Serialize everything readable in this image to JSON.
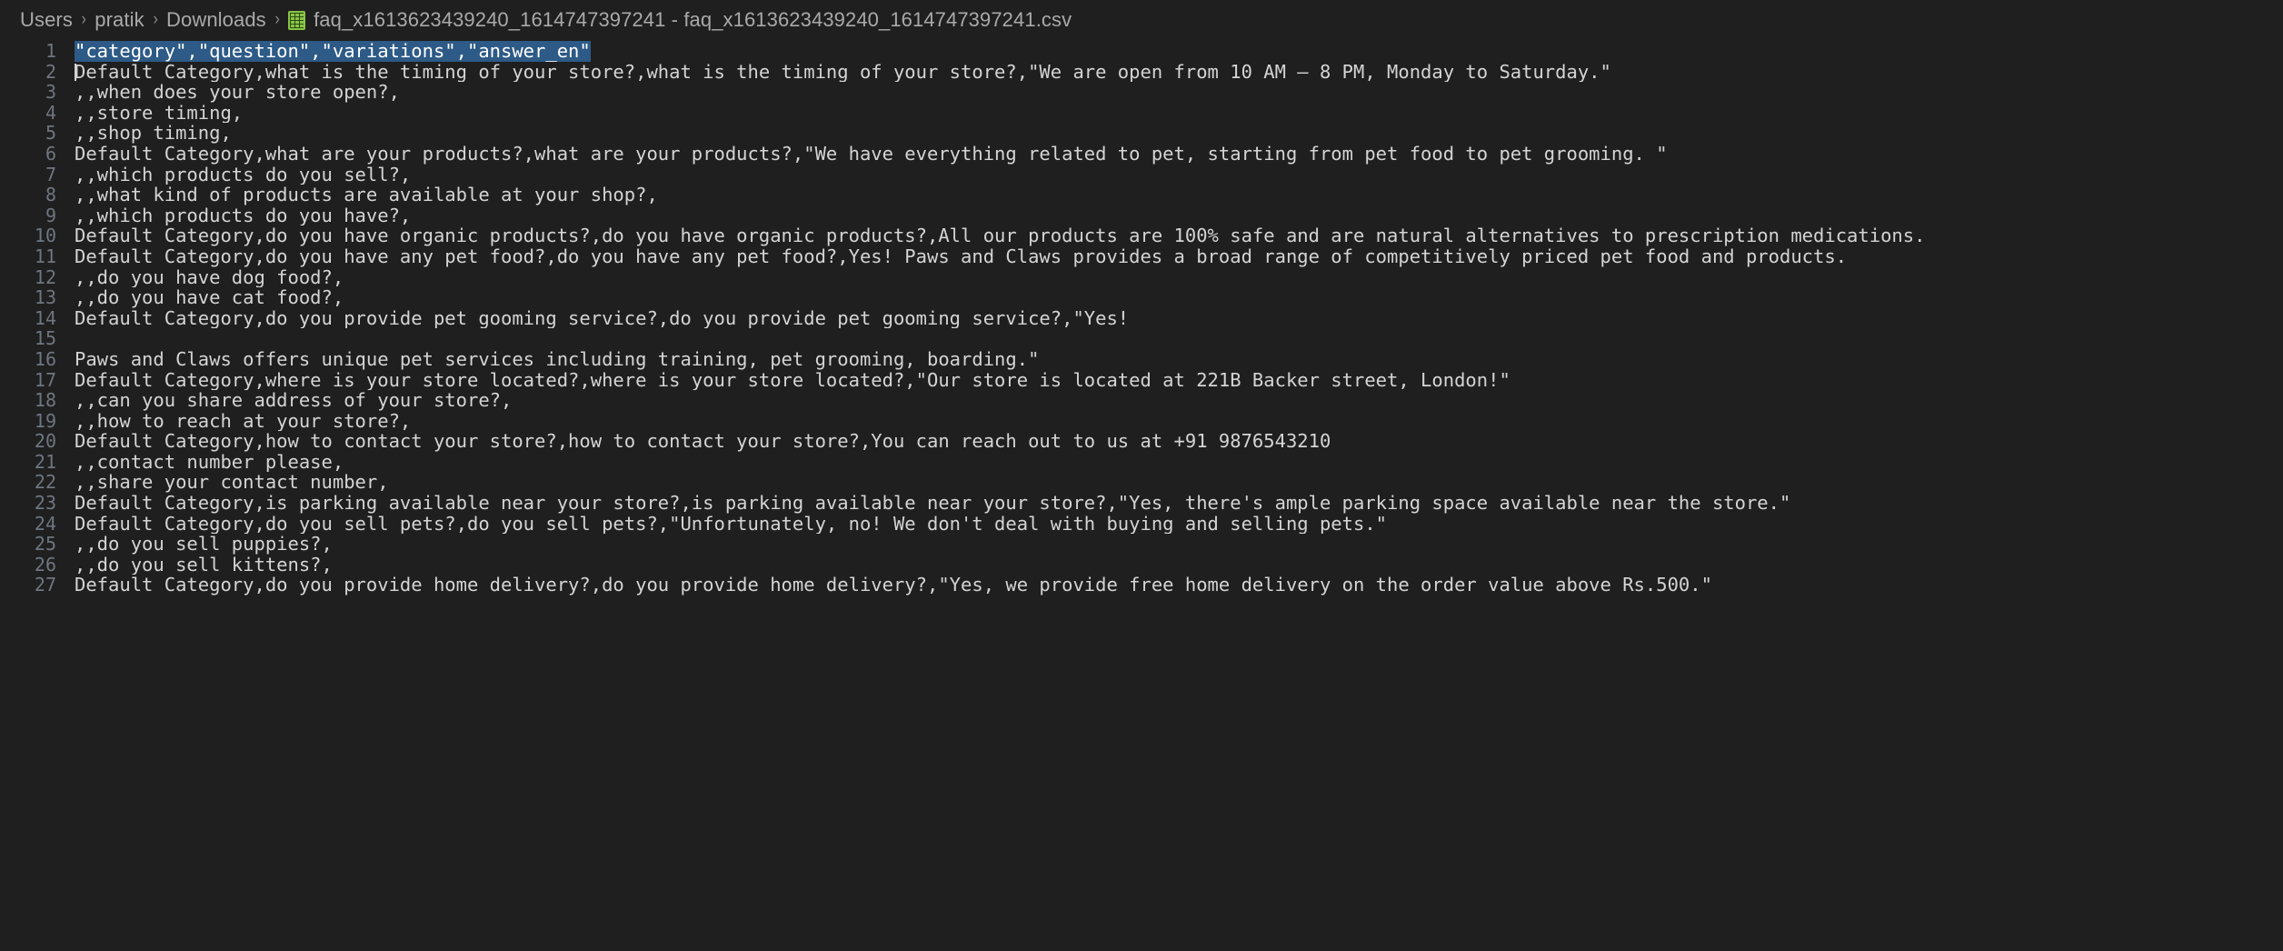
{
  "window": {
    "background_color": "#1f1f1f",
    "accent_color": "#2d5a86"
  },
  "breadcrumb": {
    "separator": "›",
    "items": [
      {
        "label": "Users"
      },
      {
        "label": "pratik"
      },
      {
        "label": "Downloads"
      }
    ],
    "file_icon_name": "csv-file-icon",
    "file_label": "faq_x1613623439240_1614747397241 - faq_x1613623439240_1614747397241.csv"
  },
  "editor": {
    "language": "csv",
    "selected_line": 1,
    "cursor_line": 2,
    "cursor_column": 1,
    "lines": [
      {
        "n": "1",
        "text": "\"category\",\"question\",\"variations\",\"answer_en\""
      },
      {
        "n": "2",
        "text": "Default Category,what is the timing of your store?,what is the timing of your store?,\"We are open from 10 AM – 8 PM, Monday to Saturday.\""
      },
      {
        "n": "3",
        "text": ",,when does your store open?,"
      },
      {
        "n": "4",
        "text": ",,store timing,"
      },
      {
        "n": "5",
        "text": ",,shop timing,"
      },
      {
        "n": "6",
        "text": "Default Category,what are your products?,what are your products?,\"We have everything related to pet, starting from pet food to pet grooming. \""
      },
      {
        "n": "7",
        "text": ",,which products do you sell?,"
      },
      {
        "n": "8",
        "text": ",,what kind of products are available at your shop?,"
      },
      {
        "n": "9",
        "text": ",,which products do you have?,"
      },
      {
        "n": "10",
        "text": "Default Category,do you have organic products?,do you have organic products?,All our products are 100% safe and are natural alternatives to prescription medications."
      },
      {
        "n": "11",
        "text": "Default Category,do you have any pet food?,do you have any pet food?,Yes! Paws and Claws provides a broad range of competitively priced pet food and products."
      },
      {
        "n": "12",
        "text": ",,do you have dog food?,"
      },
      {
        "n": "13",
        "text": ",,do you have cat food?,"
      },
      {
        "n": "14",
        "text": "Default Category,do you provide pet gooming service?,do you provide pet gooming service?,\"Yes!"
      },
      {
        "n": "15",
        "text": ""
      },
      {
        "n": "16",
        "text": "Paws and Claws offers unique pet services including training, pet grooming, boarding.\""
      },
      {
        "n": "17",
        "text": "Default Category,where is your store located?,where is your store located?,\"Our store is located at 221B Backer street, London!\""
      },
      {
        "n": "18",
        "text": ",,can you share address of your store?,"
      },
      {
        "n": "19",
        "text": ",,how to reach at your store?,"
      },
      {
        "n": "20",
        "text": "Default Category,how to contact your store?,how to contact your store?,You can reach out to us at +91 9876543210"
      },
      {
        "n": "21",
        "text": ",,contact number please,"
      },
      {
        "n": "22",
        "text": ",,share your contact number,"
      },
      {
        "n": "23",
        "text": "Default Category,is parking available near your store?,is parking available near your store?,\"Yes, there's ample parking space available near the store.\""
      },
      {
        "n": "24",
        "text": "Default Category,do you sell pets?,do you sell pets?,\"Unfortunately, no! We don't deal with buying and selling pets.\""
      },
      {
        "n": "25",
        "text": ",,do you sell puppies?,"
      },
      {
        "n": "26",
        "text": ",,do you sell kittens?,"
      },
      {
        "n": "27",
        "text": "Default Category,do you provide home delivery?,do you provide home delivery?,\"Yes, we provide free home delivery on the order value above Rs.500.\""
      }
    ]
  }
}
